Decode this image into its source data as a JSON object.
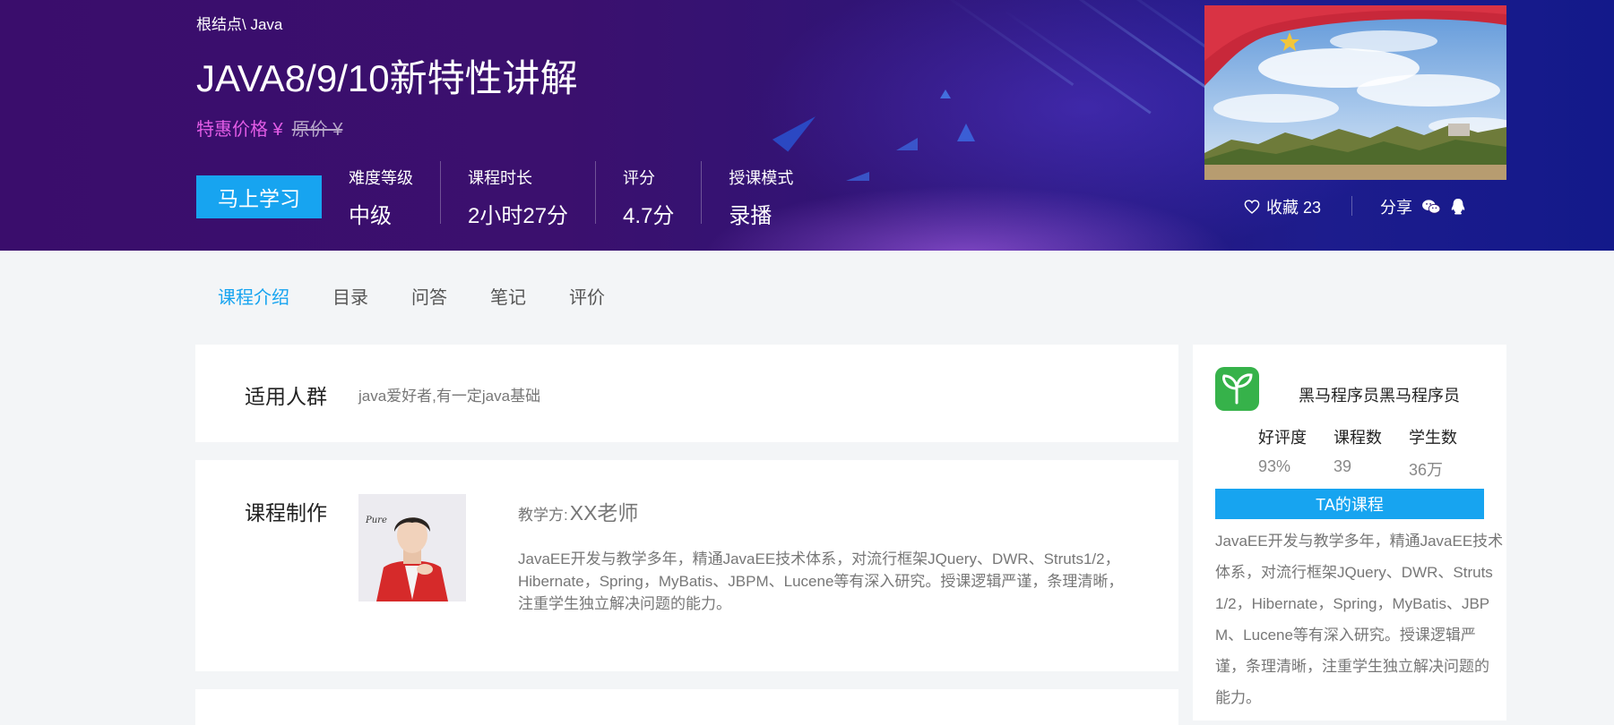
{
  "breadcrumb": "根结点\\ Java",
  "course": {
    "title": "JAVA8/9/10新特性讲解",
    "sale_price_label": "特惠价格 ¥",
    "orig_price_label": "原价 ¥"
  },
  "study_button": "马上学习",
  "stats": [
    {
      "label": "难度等级",
      "value": "中级"
    },
    {
      "label": "课程时长",
      "value": "2小时27分"
    },
    {
      "label": "评分",
      "value": "4.7分"
    },
    {
      "label": "授课模式",
      "value": "录播"
    }
  ],
  "social": {
    "favorite_label": "收藏 23",
    "share_label": "分享",
    "icons": [
      "heart-icon",
      "wechat-icon",
      "qq-icon"
    ]
  },
  "tabs": [
    {
      "label": "课程介绍",
      "active": true
    },
    {
      "label": "目录"
    },
    {
      "label": "问答"
    },
    {
      "label": "笔记"
    },
    {
      "label": "评价"
    }
  ],
  "audience": {
    "title": "适用人群",
    "text": "java爱好者,有一定java基础"
  },
  "production": {
    "title": "课程制作",
    "teacher_label": "教学方:",
    "teacher_name": "XX老师",
    "description": "JavaEE开发与教学多年，精通JavaEE技术体系，对流行框架JQuery、DWR、Struts1/2，Hibernate，Spring，MyBatis、JBPM、Lucene等有深入研究。授课逻辑严谨，条理清晰，注重学生独立解决问题的能力。"
  },
  "institution": {
    "name": "黑马程序员黑马程序员",
    "stats": [
      {
        "label": "好评度",
        "value": "93%"
      },
      {
        "label": "课程数",
        "value": "39"
      },
      {
        "label": "学生数",
        "value": "36万"
      }
    ],
    "ta_button": "TA的课程",
    "description": "JavaEE开发与教学多年，精通JavaEE技术体系，对流行框架JQuery、DWR、Struts1/2，Hibernate，Spring，MyBatis、JBPM、Lucene等有深入研究。授课逻辑严谨，条理清晰，注重学生独立解决问题的能力。"
  },
  "colors": {
    "accent": "#17a4f0",
    "price": "#e25ce6",
    "hero_start": "#3a0d6c",
    "hero_end": "#13198a"
  }
}
